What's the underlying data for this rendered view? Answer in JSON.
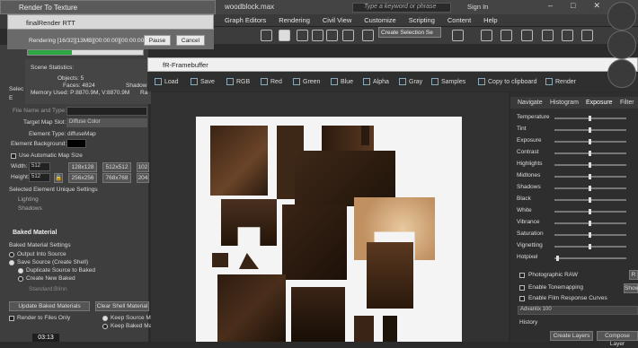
{
  "max": {
    "filename": "woodblock.max",
    "search_placeholder": "Type a keyword or phrase",
    "signin": "Sign In",
    "menus": [
      "Graph Editors",
      "Rendering",
      "Civil View",
      "Customize",
      "Scripting",
      "Content",
      "Help"
    ],
    "selection_set": "Create Selection Se"
  },
  "rtt": {
    "window_title": "Render To Texture",
    "file_name_label": "File Name and Type:",
    "target_map_label": "Target Map Slot:",
    "target_map_value": "Diffuse Color",
    "element_type_label": "Element Type:",
    "element_type_value": "diffuseMap",
    "element_bg_label": "Element Background:",
    "auto_map_size": "Use Automatic Map Size",
    "width_label": "Width:",
    "height_label": "Height:",
    "width_val": "512",
    "height_val": "512",
    "size_buttons_row1": [
      "128x128",
      "512x512",
      "102"
    ],
    "size_buttons_row2": [
      "256x256",
      "768x768",
      "204"
    ],
    "unique_settings": "Selected Element Unique Settings",
    "lighting": "Lighting",
    "shadows": "Shadows",
    "baked_material": "Baked Material",
    "baked_settings": "Baked Material Settings",
    "output_into_source": "Output Into Source",
    "save_source": "Save Source (Create Shell)",
    "duplicate_source": "Duplicate Source to Baked",
    "create_new_baked": "Create New Baked",
    "standard_blinn": "Standard:Blinn",
    "update_baked": "Update Baked Materials",
    "clear_shell": "Clear Shell Material",
    "render_to_files": "Render to Files Only",
    "keep_source": "Keep Source M",
    "keep_baked": "Keep Baked Ma",
    "sel_letter": "Selec",
    "sel_letter2": "E"
  },
  "frrtt": {
    "title": "finalRender RTT",
    "rendering": "Rendering [16/32][13MB][00:00:00][00:00:00",
    "pause": "Pause",
    "cancel": "Cancel",
    "progress": 0.38,
    "stats_title": "Scene Statistics:",
    "objects": "Objects: 5",
    "faces": "Faces: 4824",
    "memory": "Memory Used: P:8870.9M, V:8870.9M",
    "shadow": "Shadow",
    "ra": "Ra"
  },
  "fb": {
    "title": "fR-Framebuffer",
    "tools": [
      "Load",
      "Save",
      "RGB",
      "Red",
      "Green",
      "Blue",
      "Alpha",
      "Gray",
      "Samples",
      "Copy to clipboard",
      "Render"
    ],
    "tabs": [
      "Navigate",
      "Histogram",
      "Exposure",
      "Filter"
    ],
    "sliders": [
      {
        "label": "Temperature",
        "value": 0.47
      },
      {
        "label": "Tint",
        "value": 0.47
      },
      {
        "label": "Exposure",
        "value": 0.47
      },
      {
        "label": "Contrast",
        "value": 0.47
      },
      {
        "label": "Highlights",
        "value": 0.47
      },
      {
        "label": "Midtones",
        "value": 0.47
      },
      {
        "label": "Shadows",
        "value": 0.47
      },
      {
        "label": "Black",
        "value": 0.47
      },
      {
        "label": "White",
        "value": 0.47
      },
      {
        "label": "Vibrance",
        "value": 0.47
      },
      {
        "label": "Saturation",
        "value": 0.47
      },
      {
        "label": "Vignetting",
        "value": 0.47
      },
      {
        "label": "Hotpixel",
        "value": 0.02
      }
    ],
    "checks": [
      "Photographic RAW",
      "Enable Tonemapping",
      "Enable Film Response Curves"
    ],
    "reset": "R",
    "show": "Show",
    "film": "Advantix 100",
    "history": "History",
    "create_layers": "Create Layers",
    "compose_layers": "Compose Layer"
  },
  "time": "03:13"
}
